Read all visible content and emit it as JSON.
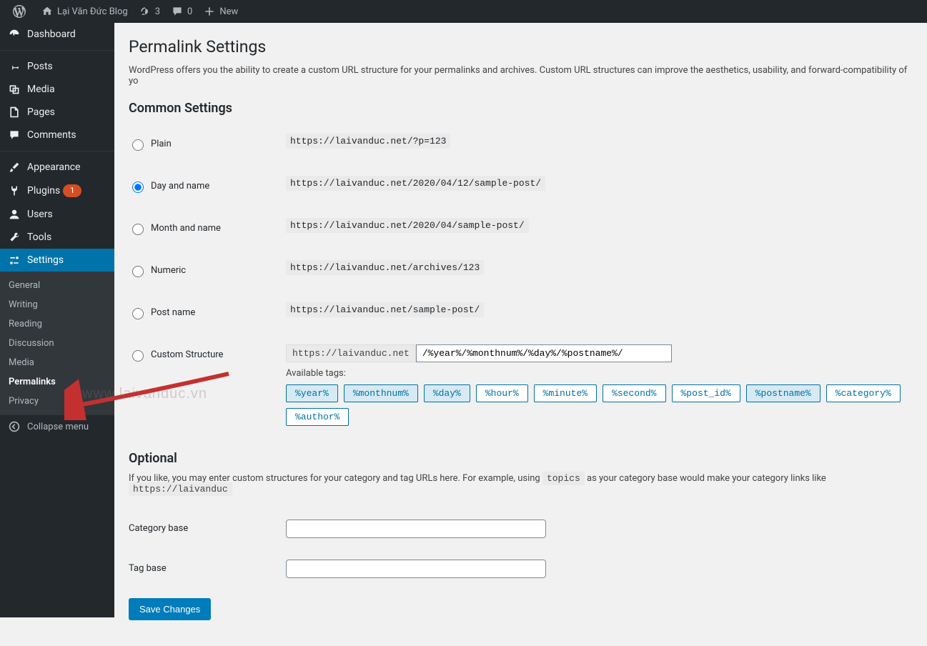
{
  "adminbar": {
    "site_name": "Lại Văn Đức Blog",
    "refresh_count": "3",
    "comments_count": "0",
    "new_label": "New"
  },
  "sidebar": {
    "items": [
      {
        "label": "Dashboard",
        "icon": "dashboard"
      },
      {
        "label": "Posts",
        "icon": "pin"
      },
      {
        "label": "Media",
        "icon": "media"
      },
      {
        "label": "Pages",
        "icon": "page"
      },
      {
        "label": "Comments",
        "icon": "comment"
      },
      {
        "label": "Appearance",
        "icon": "brush"
      },
      {
        "label": "Plugins",
        "icon": "plug",
        "badge": "1"
      },
      {
        "label": "Users",
        "icon": "user"
      },
      {
        "label": "Tools",
        "icon": "wrench"
      },
      {
        "label": "Settings",
        "icon": "settings"
      }
    ],
    "submenu": [
      {
        "label": "General"
      },
      {
        "label": "Writing"
      },
      {
        "label": "Reading"
      },
      {
        "label": "Discussion"
      },
      {
        "label": "Media"
      },
      {
        "label": "Permalinks",
        "current": true
      },
      {
        "label": "Privacy"
      }
    ],
    "collapse_label": "Collapse menu"
  },
  "page": {
    "title": "Permalink Settings",
    "intro": "WordPress offers you the ability to create a custom URL structure for your permalinks and archives. Custom URL structures can improve the aesthetics, usability, and forward-compatibility of yo",
    "common_heading": "Common Settings",
    "options": [
      {
        "label": "Plain",
        "url": "https://laivanduc.net/?p=123",
        "checked": false
      },
      {
        "label": "Day and name",
        "url": "https://laivanduc.net/2020/04/12/sample-post/",
        "checked": true
      },
      {
        "label": "Month and name",
        "url": "https://laivanduc.net/2020/04/sample-post/",
        "checked": false
      },
      {
        "label": "Numeric",
        "url": "https://laivanduc.net/archives/123",
        "checked": false
      },
      {
        "label": "Post name",
        "url": "https://laivanduc.net/sample-post/",
        "checked": false
      }
    ],
    "custom_label": "Custom Structure",
    "custom_prefix": "https://laivanduc.net",
    "custom_value": "/%year%/%monthnum%/%day%/%postname%/",
    "available_tags_label": "Available tags:",
    "tags": [
      {
        "t": "%year%",
        "a": true
      },
      {
        "t": "%monthnum%",
        "a": true
      },
      {
        "t": "%day%",
        "a": true
      },
      {
        "t": "%hour%",
        "a": false
      },
      {
        "t": "%minute%",
        "a": false
      },
      {
        "t": "%second%",
        "a": false
      },
      {
        "t": "%post_id%",
        "a": false
      },
      {
        "t": "%postname%",
        "a": true
      },
      {
        "t": "%category%",
        "a": false
      },
      {
        "t": "%author%",
        "a": false
      }
    ],
    "optional_heading": "Optional",
    "optional_desc_1": "If you like, you may enter custom structures for your category and tag URLs here. For example, using ",
    "optional_code": "topics",
    "optional_desc_2": " as your category base would make your category links like ",
    "optional_code2": "https://laivanduc",
    "category_base_label": "Category base",
    "tag_base_label": "Tag base",
    "save_label": "Save Changes"
  },
  "watermark": "www.laivanduc.vn"
}
